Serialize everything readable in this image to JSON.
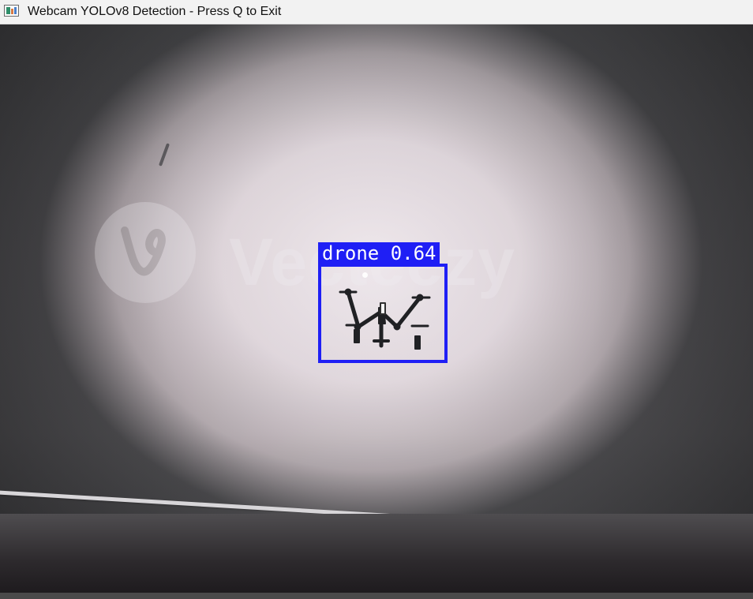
{
  "window": {
    "title": "Webcam YOLOv8 Detection - Press Q to Exit",
    "app_icon": "opencv-window-icon"
  },
  "video": {
    "watermark_text": "Vecteezy",
    "detection": {
      "class_label": "drone",
      "confidence": "0.64",
      "label_text": "drone 0.64",
      "box_color": "#1f1ff5"
    }
  },
  "colors": {
    "titlebar_bg": "#f2f2f2",
    "title_text": "#111111",
    "detection_text": "#ffffff"
  }
}
